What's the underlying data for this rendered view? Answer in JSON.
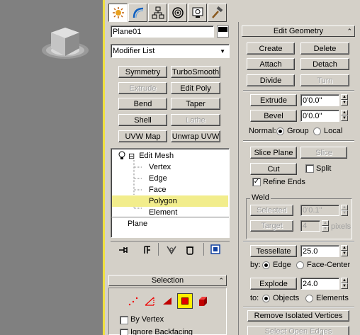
{
  "viewport": {
    "object_label": "box object"
  },
  "tabs": [
    {
      "name": "create-tab",
      "icon": "sun-icon"
    },
    {
      "name": "modify-tab",
      "icon": "bend-icon"
    },
    {
      "name": "hierarchy-tab",
      "icon": "hierarchy-icon"
    },
    {
      "name": "motion-tab",
      "icon": "motion-icon"
    },
    {
      "name": "display-tab",
      "icon": "monitor-icon"
    },
    {
      "name": "utilities-tab",
      "icon": "hammer-icon"
    }
  ],
  "object": {
    "name": "Plane01",
    "color": "#000000"
  },
  "modifier_list": {
    "value": "Modifier List"
  },
  "modifier_buttons": [
    {
      "label": "Symmetry",
      "enabled": true
    },
    {
      "label": "TurboSmooth",
      "enabled": true
    },
    {
      "label": "Extrude",
      "enabled": false
    },
    {
      "label": "Edit Poly",
      "enabled": true
    },
    {
      "label": "Bend",
      "enabled": true
    },
    {
      "label": "Taper",
      "enabled": true
    },
    {
      "label": "Shell",
      "enabled": true
    },
    {
      "label": "Lathe",
      "enabled": false
    },
    {
      "label": "UVW Map",
      "enabled": true
    },
    {
      "label": "Unwrap UVW",
      "enabled": true
    }
  ],
  "stack": {
    "modifier": "Edit Mesh",
    "collapse_sign": "⊟",
    "subobjects": [
      "Vertex",
      "Edge",
      "Face",
      "Polygon",
      "Element"
    ],
    "selected": "Polygon",
    "base": "Plane"
  },
  "selection_rollout": {
    "title": "Selection",
    "collapse": "⌃",
    "by_vertex": "By Vertex",
    "ignore_backfacing": "Ignore Backfacing"
  },
  "edit_geometry": {
    "title": "Edit Geometry",
    "collapse": "⌃",
    "create": "Create",
    "delete": "Delete",
    "attach": "Attach",
    "detach": "Detach",
    "divide": "Divide",
    "turn": "Turn",
    "extrude": "Extrude",
    "extrude_value": "0'0.0\"",
    "bevel": "Bevel",
    "bevel_value": "0'0.0\"",
    "normal_label": "Normal:",
    "group": "Group",
    "local": "Local",
    "slice_plane": "Slice Plane",
    "slice": "Slice",
    "cut": "Cut",
    "split": "Split",
    "refine_ends": "Refine Ends",
    "weld_title": "Weld",
    "selected": "Selected",
    "selected_value": "0'0.1\"",
    "target": "Target",
    "target_value": "4",
    "pixels": "pixels",
    "tessellate": "Tessellate",
    "tessellate_value": "25.0",
    "by_label": "by:",
    "edge": "Edge",
    "face_center": "Face-Center",
    "explode": "Explode",
    "explode_value": "24.0",
    "to_label": "to:",
    "objects": "Objects",
    "elements": "Elements",
    "remove_isolated": "Remove Isolated Vertices",
    "select_open_edges": "Select Open Edges"
  }
}
